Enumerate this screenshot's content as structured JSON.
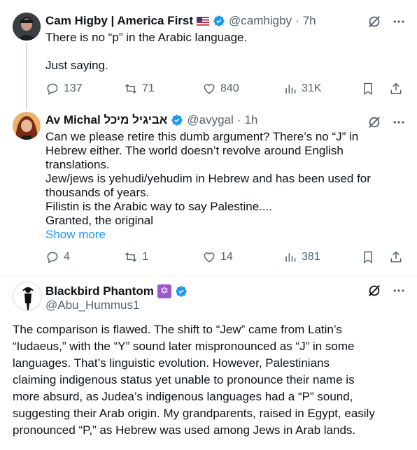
{
  "tweet1": {
    "name": "Cam Higby | America First",
    "handle": "@camhigby",
    "sep": "·",
    "time": "7h",
    "line1": "There is no “p” in the Arabic language.",
    "line2": "Just saying.",
    "replies": "137",
    "reposts": "71",
    "likes": "840",
    "views": "31K"
  },
  "tweet2": {
    "name": "Av Michal אביגיל מיכל",
    "handle": "@avygal",
    "sep": "·",
    "time": "1h",
    "lines": [
      "Can we please retire this dumb argument? There’s no “J” in",
      "Hebrew either. The world doesn’t revolve around English",
      "translations.",
      "Jew/jews is yehudi/yehudim in Hebrew and has been used for",
      "thousands of years.",
      "Filistin is the Arabic way to say Palestine....",
      "Granted, the original"
    ],
    "show_more": "Show more",
    "replies": "4",
    "reposts": "1",
    "likes": "14",
    "views": "381"
  },
  "tweet3": {
    "name": "Blackbird Phantom",
    "handle": "@Abu_Hummus1",
    "lines": [
      "The comparison is flawed. The shift to “Jew” came from Latin’s",
      "“Iudaeus,” with the “Y” sound later mispronounced as “J” in some",
      "languages. That’s linguistic evolution. However, Palestinians",
      "claiming indigenous status yet unable to pronounce their name is",
      "more absurd, as Judea’s indigenous languages had a “P” sound,",
      "suggesting their Arab origin. My grandparents, raised in Egypt, easily",
      "pronounced “P,” as Hebrew was used among Jews in Arab lands."
    ]
  },
  "icons": {
    "verified_color": "#1d9bf0",
    "accent": "#1d9bf0",
    "muted": "#536471"
  }
}
